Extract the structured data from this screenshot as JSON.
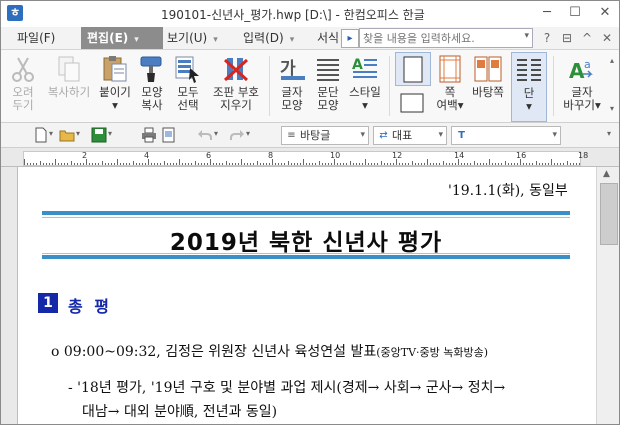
{
  "window": {
    "title": "190101-신년사_평가.hwp [D:\\] - 한컴오피스 한글",
    "app_icon_letter": "ㅎ",
    "controls": [
      "─",
      "☐",
      "✕"
    ]
  },
  "menubar": {
    "items": [
      {
        "label": "파일(F)",
        "active": false
      },
      {
        "label": "편집(E)",
        "active": true
      },
      {
        "label": "보기(U)",
        "active": false
      },
      {
        "label": "입력(D)",
        "active": false
      },
      {
        "label": "서식",
        "active": false
      }
    ],
    "more_glyph": "▸",
    "search_placeholder": "찾을 내용을 입력하세요.",
    "search_dropdown": "▾"
  },
  "ribbon": {
    "buttons": [
      {
        "label1": "오려",
        "label2": "두기",
        "disabled": true
      },
      {
        "label1": "복사하기",
        "label2": "",
        "disabled": true
      },
      {
        "label1": "붙이기",
        "label2": "▾",
        "disabled": false
      },
      {
        "label1": "모양",
        "label2": "복사",
        "disabled": false
      },
      {
        "label1": "모두",
        "label2": "선택",
        "disabled": false
      },
      {
        "label1": "조판 부호",
        "label2": "지우기",
        "disabled": false
      },
      {
        "label1": "글자",
        "label2": "모양",
        "disabled": false
      },
      {
        "label1": "문단",
        "label2": "모양",
        "disabled": false
      },
      {
        "label1": "스타일",
        "label2": "▾",
        "disabled": false
      },
      {
        "label1": "쪽",
        "label2": "여백▾",
        "disabled": false
      },
      {
        "label1": "바탕쪽",
        "label2": "",
        "disabled": false
      },
      {
        "label1": "단",
        "label2": "▾",
        "disabled": false
      },
      {
        "label1": "글자",
        "label2": "바꾸기▾",
        "disabled": false
      }
    ],
    "glyph_font": "가",
    "scroll_up": "▴",
    "scroll_down": "▾"
  },
  "toolbar": {
    "style_combo": "바탕글",
    "font_lang_combo": "대표",
    "font_combo": "",
    "dd": "▾"
  },
  "ruler": {
    "numbers": [
      "2",
      "4",
      "6",
      "8",
      "10",
      "12",
      "14",
      "16",
      "18"
    ]
  },
  "document": {
    "date": "'19.1.1(화), 동일부",
    "title": "2019년 북한 신년사 평가",
    "section_number": "1",
    "section_title": "총 평",
    "bullet1_text": "o 09:00~09:32, 김정은 위원장 신년사 육성연설 발표",
    "bullet1_small": "(중앙TV·중방 녹화방송)",
    "bullet2_line1": "- '18년 평가, '19년 구호 및 분야별 과업 제시(경제→ 사회→ 군사→ 정치→",
    "bullet2_line2": "대남→ 대외 분야順, 전년과 동일)"
  }
}
